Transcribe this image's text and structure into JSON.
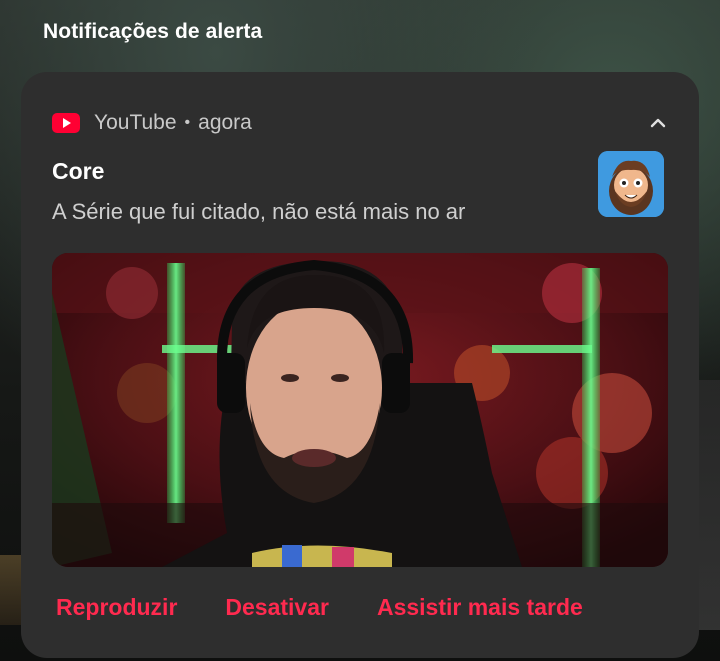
{
  "section": {
    "title": "Notificações de alerta"
  },
  "notification": {
    "app_name": "YouTube",
    "separator": "•",
    "time": "agora",
    "title": "Core",
    "text": "A Série que fui citado, não está mais no ar",
    "icons": {
      "app": "youtube-icon",
      "collapse": "chevron-up-icon",
      "avatar": "channel-avatar"
    },
    "actions": [
      "Reproduzir",
      "Desativar",
      "Assistir mais tarde"
    ]
  },
  "colors": {
    "card_background": "#2e2e2e",
    "action_color": "#ff2a4f",
    "youtube_red": "#ff0033"
  }
}
